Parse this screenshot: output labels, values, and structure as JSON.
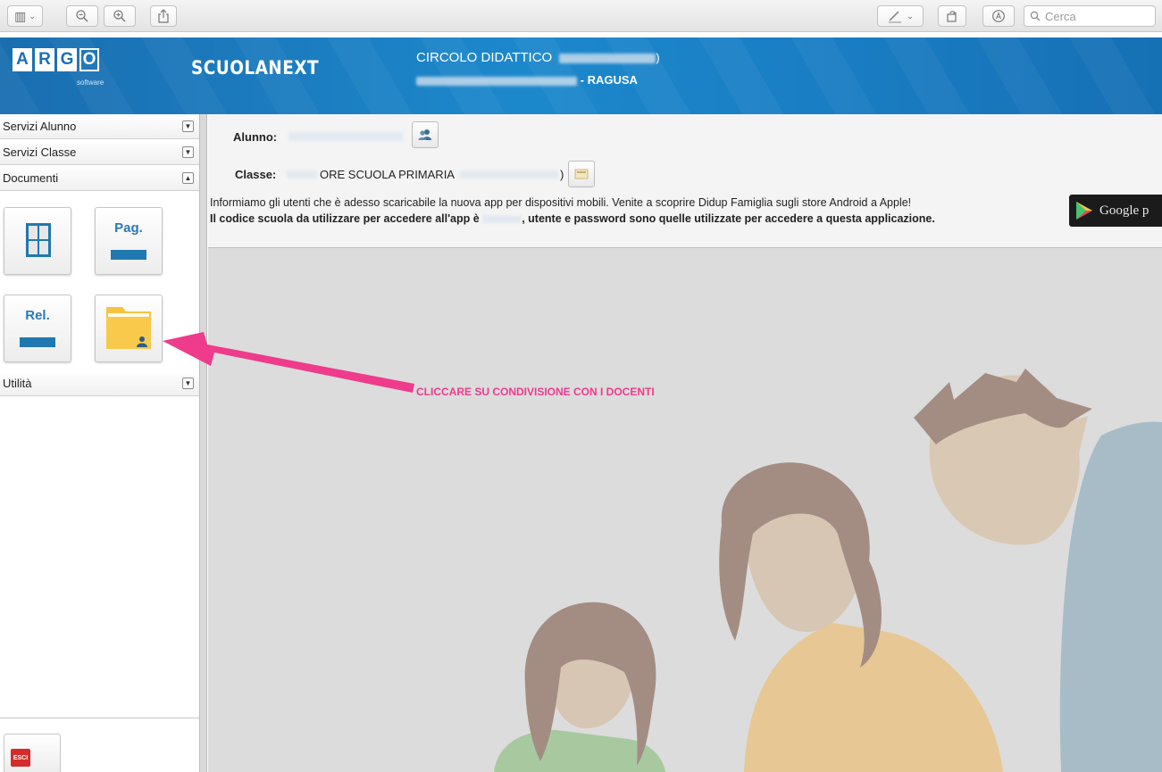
{
  "viewer_toolbar": {
    "search_placeholder": "Cerca"
  },
  "header": {
    "logo_letters": [
      "A",
      "R",
      "G",
      "O"
    ],
    "logo_sub": "software",
    "app_name": "SCUOLANEXT",
    "school_name": "CIRCOLO DIDATTICO",
    "school_address_suffix": "- RAGUSA"
  },
  "sidebar": {
    "sections": [
      {
        "label": "Servizi Alunno",
        "state": "collapsed"
      },
      {
        "label": "Servizi Classe",
        "state": "collapsed"
      },
      {
        "label": "Documenti",
        "state": "expanded"
      },
      {
        "label": "Utilità",
        "state": "collapsed"
      }
    ],
    "tiles": [
      {
        "icon": "grid-document-icon",
        "label": ""
      },
      {
        "icon": "page-icon",
        "label": "Pag."
      },
      {
        "icon": "report-icon",
        "label": "Rel."
      },
      {
        "icon": "shared-folder-icon",
        "label": ""
      }
    ],
    "exit_label": "ESCI"
  },
  "student_info": {
    "student_label": "Alunno:",
    "class_label": "Classe:",
    "class_value": "ORE SCUOLA PRIMARIA",
    "notice_line1": "Informiamo gli utenti che è adesso scaricabile la nuova app per dispositivi mobili. Venite a scoprire Didup Famiglia sugli store Android a Apple!",
    "notice_line2_a": "Il codice scuola da utilizzare per accedere all'app è",
    "notice_line2_b": ", utente e password sono quelle utilizzate per accedere a questa applicazione.",
    "store_badge_text": "Google p"
  },
  "annotation": {
    "callout_text": "CLICCARE SU CONDIVISIONE CON I DOCENTI",
    "color": "#ee3b8c"
  },
  "colors": {
    "banner_blue": "#1c88cc",
    "tile_blue": "#1f78b0",
    "folder_yellow": "#f6c342",
    "exit_red": "#d62b2b"
  }
}
